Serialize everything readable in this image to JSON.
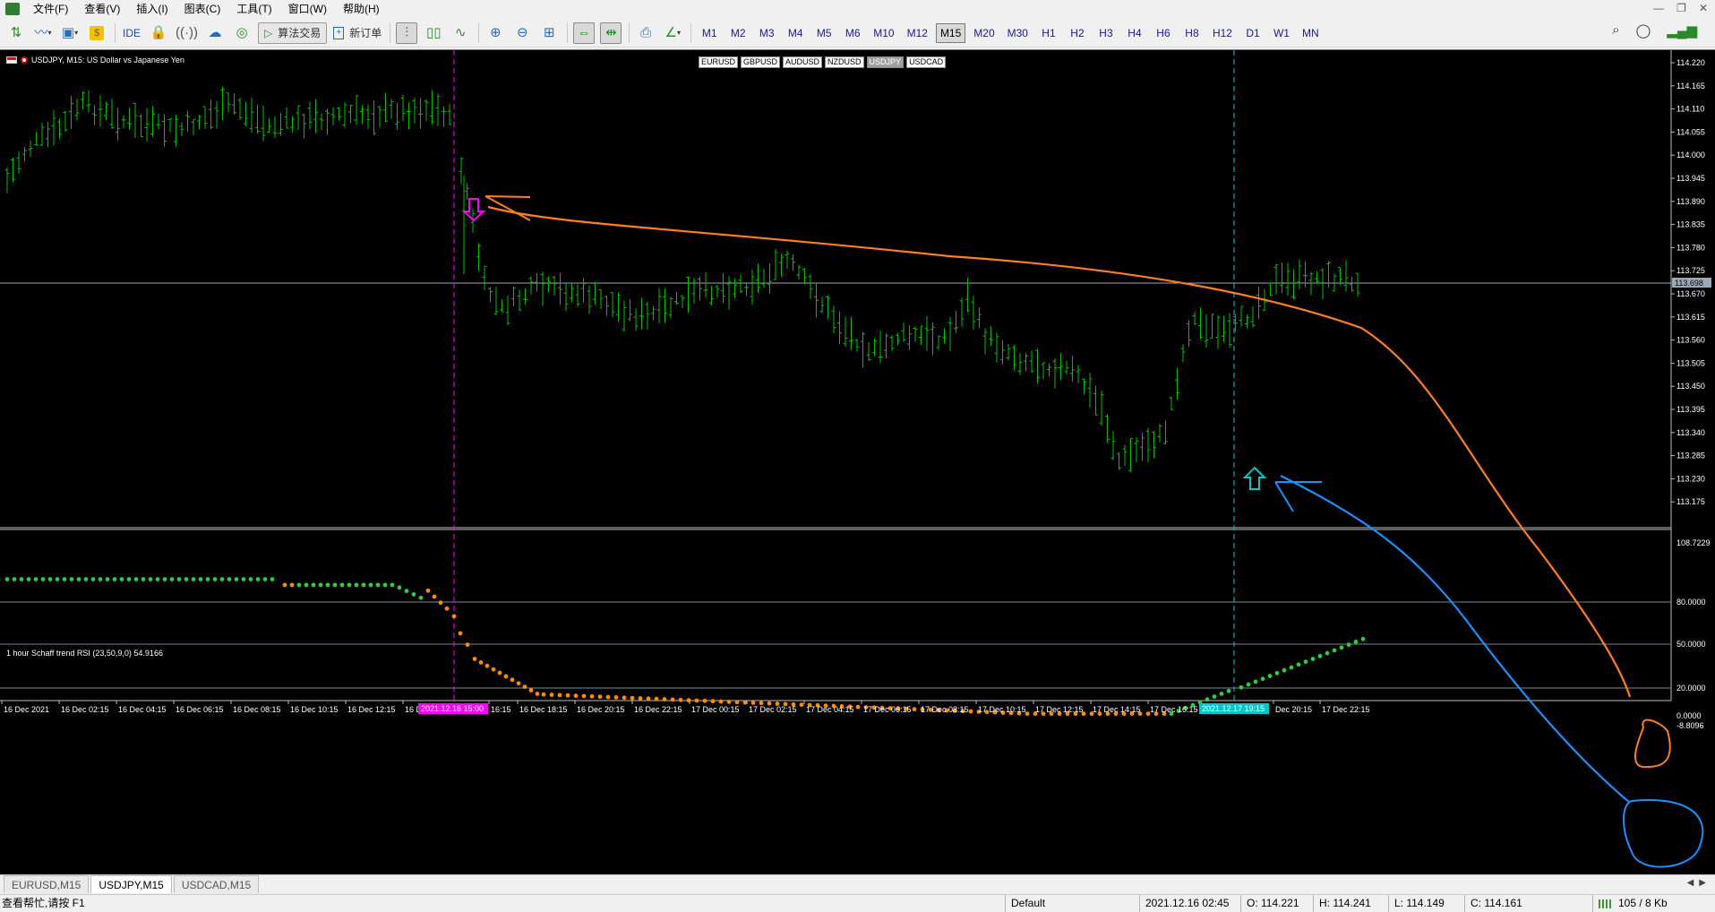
{
  "menubar": {
    "items": [
      "文件(F)",
      "查看(V)",
      "插入(I)",
      "图表(C)",
      "工具(T)",
      "窗口(W)",
      "帮助(H)"
    ]
  },
  "toolbar": {
    "ide_label": "IDE",
    "algo_trading_label": "算法交易",
    "new_order_label": "新订单",
    "timeframes": [
      "M1",
      "M2",
      "M3",
      "M4",
      "M5",
      "M6",
      "M10",
      "M12",
      "M15",
      "M20",
      "M30",
      "H1",
      "H2",
      "H3",
      "H4",
      "H6",
      "H8",
      "H12",
      "D1",
      "W1",
      "MN"
    ],
    "active_timeframe": "M15"
  },
  "chart": {
    "title": "USDJPY, M15:  US Dollar vs Japanese Yen",
    "symbol_tabs": [
      "EURUSD",
      "GBPUSD",
      "AUDUSD",
      "NZDUSD",
      "USDJPY",
      "USDCAD"
    ],
    "active_symbol": "USDJPY",
    "price_levels": [
      "114.220",
      "114.165",
      "114.110",
      "114.055",
      "114.000",
      "113.945",
      "113.890",
      "113.835",
      "113.780",
      "113.725",
      "113.670",
      "113.615",
      "113.560",
      "113.505",
      "113.450",
      "113.395",
      "113.340",
      "113.285",
      "113.230",
      "113.175"
    ],
    "current_price_label": "113.698",
    "time_labels": [
      "16 Dec 2021",
      "16 Dec 02:15",
      "16 Dec 04:15",
      "16 Dec 06:15",
      "16 Dec 08:15",
      "16 Dec 10:15",
      "16 Dec 12:15",
      "16 D",
      "16:15",
      "16 Dec 18:15",
      "16 Dec 20:15",
      "16 Dec 22:15",
      "17 Dec 00:15",
      "17 Dec 02:15",
      "17 Dec 04:15",
      "17 Dec 06:15",
      "17 Dec 08:15",
      "17 Dec 10:15",
      "17 Dec 12:15",
      "17 Dec 14:15",
      "17 Dec 16:15",
      "Dec 20:15",
      "17 Dec 22:15"
    ],
    "magenta_marker_label": "2021.12.16 15:00",
    "cyan_marker_label": "2021.12.17 19:15",
    "colors": {
      "background": "#000000",
      "candles": "#00c000",
      "magenta_line": "#ff00ff",
      "cyan_line": "#00c8c8",
      "orange_annotation": "#ff7f27",
      "blue_annotation": "#1e90ff",
      "rsi_green": "#2ecc40",
      "rsi_orange": "#ff8c00"
    }
  },
  "indicator": {
    "title": "1 hour Schaff trend RSI (23,50,9,0) 54.9166",
    "levels": [
      "108.7229",
      "80.0000",
      "50.0000",
      "20.0000",
      "0.0000",
      "-8.8096"
    ]
  },
  "chart_tabs": [
    "EURUSD,M15",
    "USDJPY,M15",
    "USDCAD,M15"
  ],
  "active_chart_tab": "USDJPY,M15",
  "statusbar": {
    "help_text": "查看帮忙,请按 F1",
    "profile": "Default",
    "datetime": "2021.12.16 02:45",
    "open": "O: 114.221",
    "high": "H: 114.241",
    "low": "L: 114.149",
    "close": "C: 114.161",
    "traffic": "105 / 8 Kb"
  }
}
